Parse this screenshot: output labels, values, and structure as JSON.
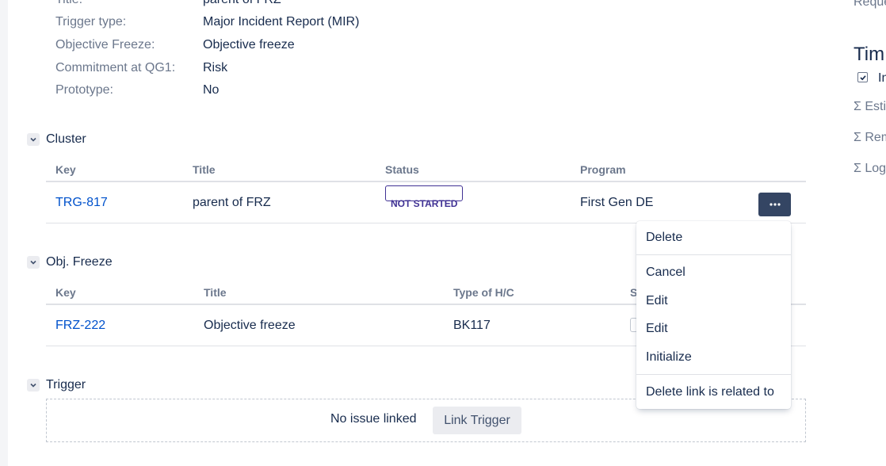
{
  "fields": [
    {
      "label": "Title:",
      "value": "parent of FRZ"
    },
    {
      "label": "Trigger type:",
      "value": "Major Incident Report (MIR)"
    },
    {
      "label": "Objective Freeze:",
      "value": "Objective freeze"
    },
    {
      "label": "Commitment at QG1:",
      "value": "Risk"
    },
    {
      "label": "Prototype:",
      "value": "No"
    }
  ],
  "cluster": {
    "title": "Cluster",
    "headers": {
      "key": "Key",
      "title": "Title",
      "status": "Status",
      "program": "Program"
    },
    "row": {
      "key": "TRG-817",
      "title": "parent of FRZ",
      "status": "NOT STARTED",
      "program": "First Gen DE"
    }
  },
  "objfreeze": {
    "title": "Obj. Freeze",
    "headers": {
      "key": "Key",
      "title": "Title",
      "type": "Type of H/C",
      "status": "S"
    },
    "row": {
      "key": "FRZ-222",
      "title": "Objective freeze",
      "type": "BK117"
    }
  },
  "trigger": {
    "title": "Trigger",
    "empty_text": "No issue linked",
    "link_button": "Link Trigger"
  },
  "dropdown": {
    "items": [
      "Delete",
      "Cancel",
      "Edit",
      "Edit",
      "Initialize",
      "Delete link is related to"
    ]
  },
  "right_panel": {
    "top_text": "Reque",
    "title": "Tim",
    "check_label": "In",
    "estimated": "Σ Estim",
    "remaining": "Σ Rem",
    "logged": "Σ Log"
  },
  "colors": {
    "link": "#0052cc",
    "lozenge": "#403294",
    "more_button": "#344563"
  }
}
